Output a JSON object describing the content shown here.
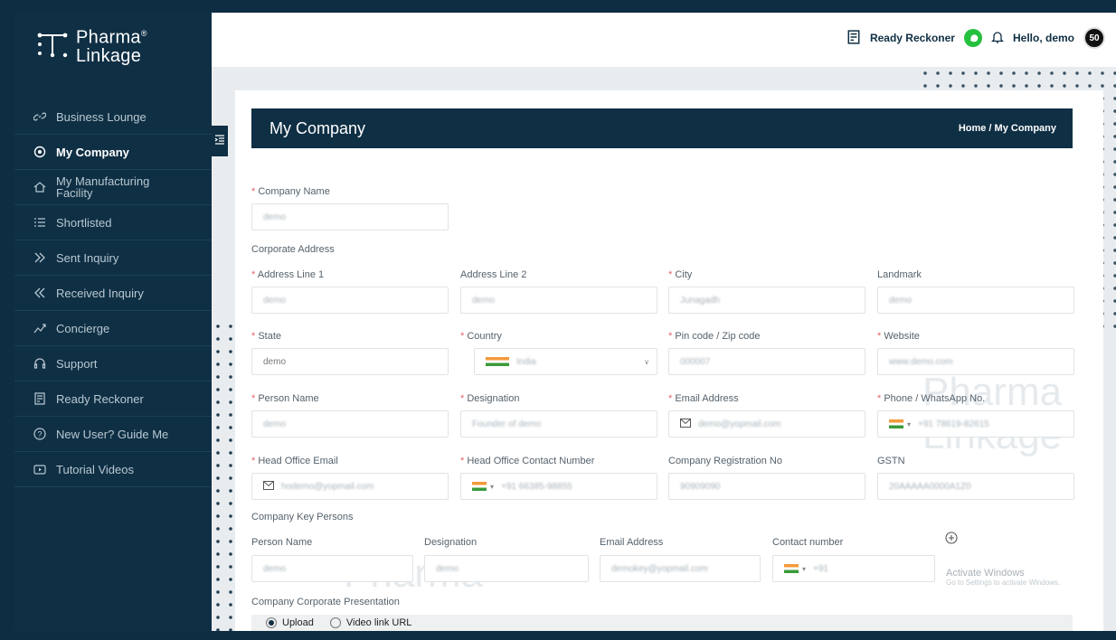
{
  "brand": {
    "name_line1": "Pharma",
    "registered": "®",
    "name_line2": "Linkage"
  },
  "sidebar": {
    "items": [
      {
        "label": "Business Lounge",
        "icon": "link-icon",
        "active": false
      },
      {
        "label": "My Company",
        "icon": "location-pin-icon",
        "active": true
      },
      {
        "label": "My Manufacturing Facility",
        "icon": "home-icon",
        "active": false
      },
      {
        "label": "Shortlisted",
        "icon": "list-icon",
        "active": false
      },
      {
        "label": "Sent Inquiry",
        "icon": "double-chevron-right-icon",
        "active": false
      },
      {
        "label": "Received Inquiry",
        "icon": "double-chevron-left-icon",
        "active": false
      },
      {
        "label": "Concierge",
        "icon": "trend-icon",
        "active": false
      },
      {
        "label": "Support",
        "icon": "headset-icon",
        "active": false
      },
      {
        "label": "Ready Reckoner",
        "icon": "receipt-icon",
        "active": false
      },
      {
        "label": "New User? Guide Me",
        "icon": "help-icon",
        "active": false
      },
      {
        "label": "Tutorial Videos",
        "icon": "video-icon",
        "active": false
      }
    ]
  },
  "topbar": {
    "ready_reckoner": "Ready Reckoner",
    "greeting": "Hello, demo",
    "badge": "50"
  },
  "page": {
    "title": "My Company",
    "breadcrumb": "Home / My Company",
    "company_name": {
      "label": "Company Name",
      "value": "demo"
    },
    "corporate_address_title": "Corporate Address",
    "fields": {
      "address1": {
        "label": "Address Line 1",
        "value": "demo"
      },
      "address2": {
        "label": "Address Line 2",
        "value": "demo"
      },
      "city": {
        "label": "City",
        "value": "Junagadh"
      },
      "landmark": {
        "label": "Landmark",
        "value": "demo"
      },
      "state": {
        "label": "State",
        "value": "demo"
      },
      "country": {
        "label": "Country",
        "value": "India"
      },
      "pin": {
        "label": "Pin code / Zip code",
        "value": "000007"
      },
      "website": {
        "label": "Website",
        "value": "www.demo.com"
      },
      "person_name": {
        "label": "Person Name",
        "value": "demo"
      },
      "designation": {
        "label": "Designation",
        "value": "Founder of demo"
      },
      "email": {
        "label": "Email Address",
        "value": "demo@yopmail.com"
      },
      "phone": {
        "label": "Phone / WhatsApp No.",
        "value": "+91 78619-82615"
      },
      "ho_email": {
        "label": "Head Office Email",
        "value": "hodemo@yopmail.com"
      },
      "ho_contact": {
        "label": "Head Office Contact Number",
        "value": "+91 66385-98855"
      },
      "reg_no": {
        "label": "Company Registration No",
        "value": "90909090"
      },
      "gstn": {
        "label": "GSTN",
        "value": "20AAAAA0000A1Z0"
      }
    },
    "key_persons_title": "Company Key Persons",
    "key_persons": {
      "headers": [
        "Person Name",
        "Designation",
        "Email Address",
        "Contact number"
      ],
      "row": {
        "name": "demo",
        "designation": "demo",
        "email": "demokey@yopmail.com",
        "contact": "+91"
      }
    },
    "presentation_title": "Company Corporate Presentation",
    "upload_options": [
      "Upload",
      "Video link URL"
    ],
    "upload_selected": "Upload"
  },
  "watermark": {
    "line1": "Pharma",
    "line2": "Linkage"
  },
  "activate_windows": {
    "title": "Activate Windows",
    "subtitle": "Go to Settings to activate Windows."
  }
}
